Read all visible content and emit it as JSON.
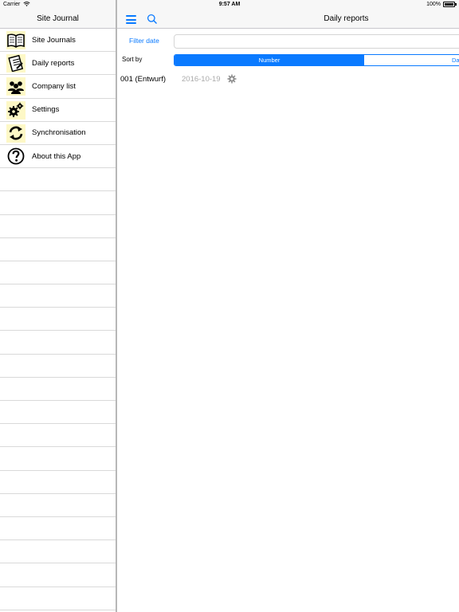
{
  "status": {
    "carrier": "Carrier",
    "time": "9:57 AM",
    "battery": "100%"
  },
  "sidebar": {
    "title": "Site Journal",
    "items": [
      {
        "label": "Site Journals",
        "icon": "book-icon"
      },
      {
        "label": "Daily reports",
        "icon": "notepad-icon"
      },
      {
        "label": "Company list",
        "icon": "people-icon"
      },
      {
        "label": "Settings",
        "icon": "gears-icon"
      },
      {
        "label": "Synchronisation",
        "icon": "sync-icon"
      },
      {
        "label": "About this App",
        "icon": "question-icon"
      }
    ]
  },
  "header": {
    "title": "Daily reports"
  },
  "filter": {
    "label": "Filter date",
    "value": ""
  },
  "sort": {
    "label": "Sort by",
    "options": [
      "Number",
      "Da"
    ],
    "selected": "Number"
  },
  "reports": [
    {
      "name": "001 (Entwurf)",
      "date": "2016-10-19"
    }
  ],
  "colors": {
    "accent": "#0a7aff",
    "muted": "#aaaaaa",
    "icon_bg": "#fdf8c6"
  }
}
